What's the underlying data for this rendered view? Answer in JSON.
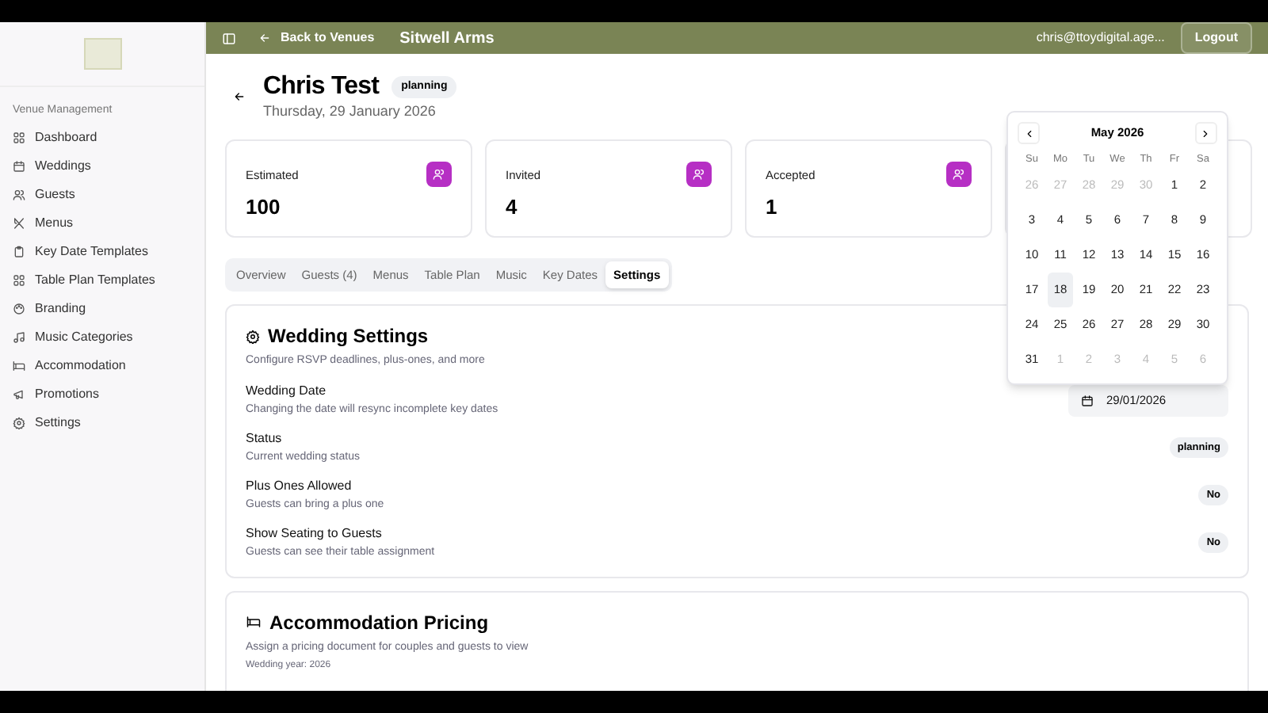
{
  "sidebar": {
    "section_label": "Venue Management",
    "items": [
      {
        "label": "Dashboard",
        "selected": false
      },
      {
        "label": "Weddings",
        "selected": false
      },
      {
        "label": "Guests",
        "selected": false
      },
      {
        "label": "Menus",
        "selected": false
      },
      {
        "label": "Key Date Templates",
        "selected": false
      },
      {
        "label": "Table Plan Templates",
        "selected": false
      },
      {
        "label": "Branding",
        "selected": false
      },
      {
        "label": "Music Categories",
        "selected": false
      },
      {
        "label": "Accommodation",
        "selected": false
      },
      {
        "label": "Promotions",
        "selected": false
      },
      {
        "label": "Settings",
        "selected": false
      }
    ]
  },
  "header": {
    "back_link": "Back to Venues",
    "venue": "Sitwell Arms",
    "user_email": "chris@ttoydigital.age...",
    "logout": "Logout"
  },
  "wedding": {
    "name": "Chris Test",
    "status_badge": "planning",
    "date": "Thursday, 29 January 2026"
  },
  "stats": [
    {
      "label": "Estimated",
      "value": "100"
    },
    {
      "label": "Invited",
      "value": "4"
    },
    {
      "label": "Accepted",
      "value": "1"
    }
  ],
  "tabs": [
    {
      "label": "Overview",
      "selected": false
    },
    {
      "label": "Guests (4)",
      "selected": false
    },
    {
      "label": "Menus",
      "selected": false
    },
    {
      "label": "Table Plan",
      "selected": false
    },
    {
      "label": "Music",
      "selected": false
    },
    {
      "label": "Key Dates",
      "selected": false
    },
    {
      "label": "Settings",
      "selected": true
    }
  ],
  "settings_card": {
    "title": "Wedding Settings",
    "subtitle": "Configure RSVP deadlines, plus-ones, and more",
    "rows": [
      {
        "kind": "date",
        "label": "Wedding Date",
        "description": "Changing the date will resync incomplete key dates",
        "value": "29/01/2026"
      },
      {
        "kind": "badge",
        "label": "Status",
        "description": "Current wedding status",
        "value": "planning"
      },
      {
        "kind": "badge",
        "label": "Plus Ones Allowed",
        "description": "Guests can bring a plus one",
        "value": "No"
      },
      {
        "kind": "badge",
        "label": "Show Seating to Guests",
        "description": "Guests can see their table assignment",
        "value": "No"
      }
    ]
  },
  "accommodation_card": {
    "title": "Accommodation Pricing",
    "subtitle": "Assign a pricing document for couples and guests to view",
    "note": "Wedding year: 2026"
  },
  "calendar": {
    "month": "May 2026",
    "weekdays": [
      "Su",
      "Mo",
      "Tu",
      "We",
      "Th",
      "Fr",
      "Sa"
    ],
    "weeks": [
      [
        {
          "day": "26",
          "outside": true,
          "today": false
        },
        {
          "day": "27",
          "outside": true,
          "today": false
        },
        {
          "day": "28",
          "outside": true,
          "today": false
        },
        {
          "day": "29",
          "outside": true,
          "today": false
        },
        {
          "day": "30",
          "outside": true,
          "today": false
        },
        {
          "day": "1",
          "outside": false,
          "today": false
        },
        {
          "day": "2",
          "outside": false,
          "today": false
        }
      ],
      [
        {
          "day": "3",
          "outside": false,
          "today": false
        },
        {
          "day": "4",
          "outside": false,
          "today": false
        },
        {
          "day": "5",
          "outside": false,
          "today": false
        },
        {
          "day": "6",
          "outside": false,
          "today": false
        },
        {
          "day": "7",
          "outside": false,
          "today": false
        },
        {
          "day": "8",
          "outside": false,
          "today": false
        },
        {
          "day": "9",
          "outside": false,
          "today": false
        }
      ],
      [
        {
          "day": "10",
          "outside": false,
          "today": false
        },
        {
          "day": "11",
          "outside": false,
          "today": false
        },
        {
          "day": "12",
          "outside": false,
          "today": false
        },
        {
          "day": "13",
          "outside": false,
          "today": false
        },
        {
          "day": "14",
          "outside": false,
          "today": false
        },
        {
          "day": "15",
          "outside": false,
          "today": false
        },
        {
          "day": "16",
          "outside": false,
          "today": false
        }
      ],
      [
        {
          "day": "17",
          "outside": false,
          "today": false
        },
        {
          "day": "18",
          "outside": false,
          "today": true
        },
        {
          "day": "19",
          "outside": false,
          "today": false
        },
        {
          "day": "20",
          "outside": false,
          "today": false
        },
        {
          "day": "21",
          "outside": false,
          "today": false
        },
        {
          "day": "22",
          "outside": false,
          "today": false
        },
        {
          "day": "23",
          "outside": false,
          "today": false
        }
      ],
      [
        {
          "day": "24",
          "outside": false,
          "today": false
        },
        {
          "day": "25",
          "outside": false,
          "today": false
        },
        {
          "day": "26",
          "outside": false,
          "today": false
        },
        {
          "day": "27",
          "outside": false,
          "today": false
        },
        {
          "day": "28",
          "outside": false,
          "today": false
        },
        {
          "day": "29",
          "outside": false,
          "today": false
        },
        {
          "day": "30",
          "outside": false,
          "today": false
        }
      ],
      [
        {
          "day": "31",
          "outside": false,
          "today": false
        },
        {
          "day": "1",
          "outside": true,
          "today": false
        },
        {
          "day": "2",
          "outside": true,
          "today": false
        },
        {
          "day": "3",
          "outside": true,
          "today": false
        },
        {
          "day": "4",
          "outside": true,
          "today": false
        },
        {
          "day": "5",
          "outside": true,
          "today": false
        },
        {
          "day": "6",
          "outside": true,
          "today": false
        }
      ]
    ]
  }
}
